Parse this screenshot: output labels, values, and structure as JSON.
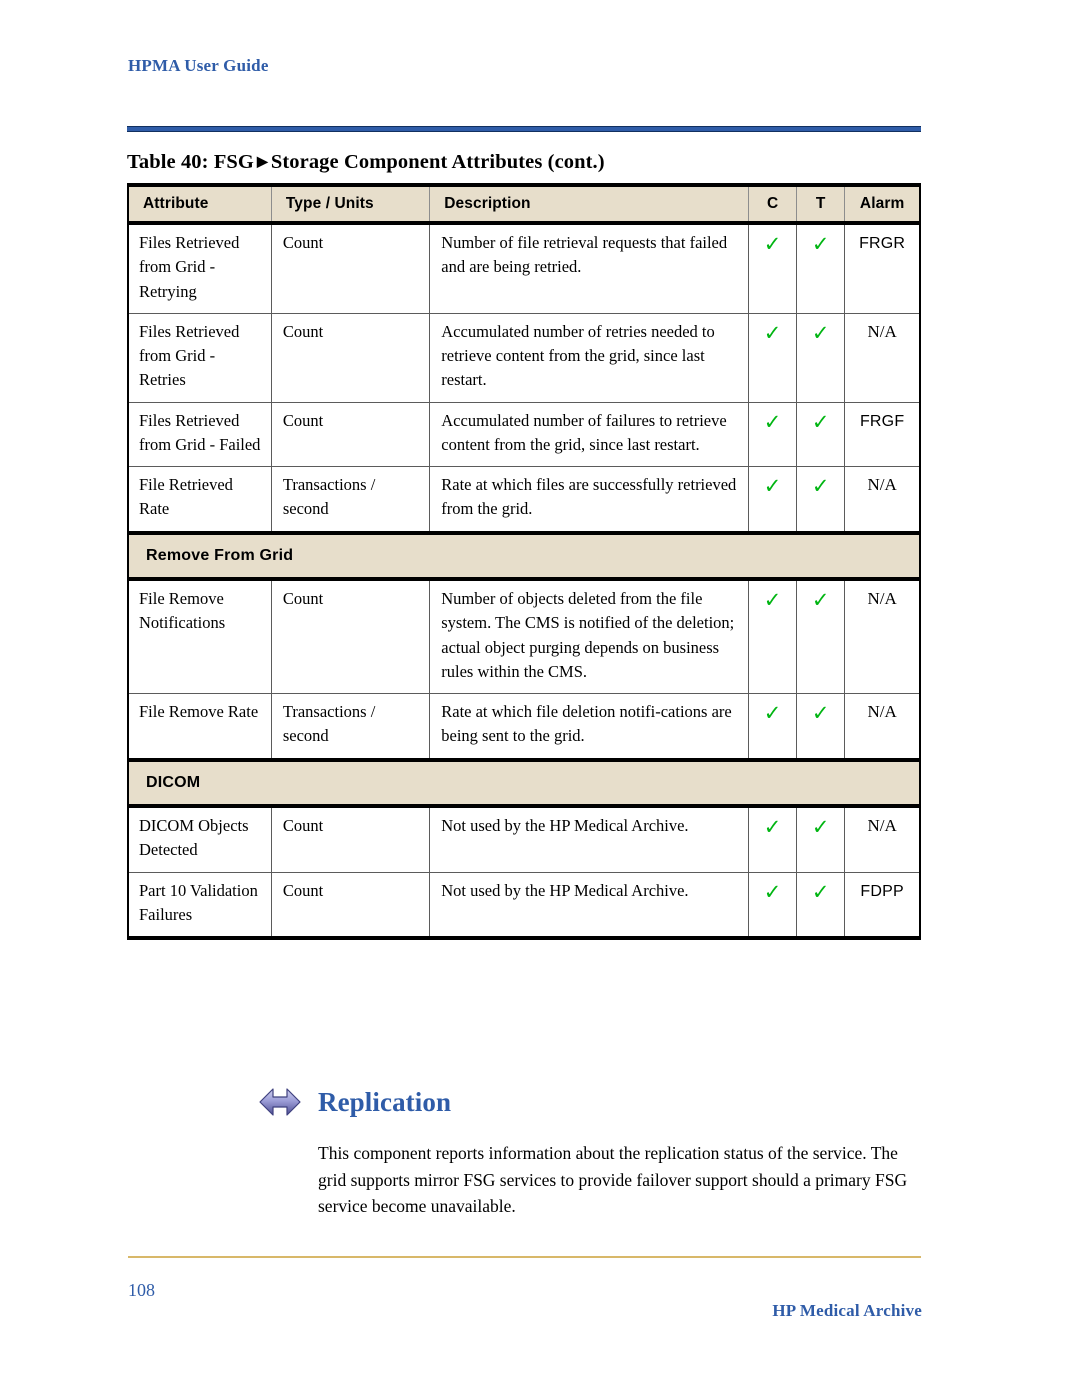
{
  "header": {
    "running_title": "HPMA User Guide"
  },
  "table": {
    "caption_prefix": "Table 40: FSG",
    "caption_arrow": "▶",
    "caption_suffix": "Storage Component Attributes (cont.)",
    "columns": [
      "Attribute",
      "Type / Units",
      "Description",
      "C",
      "T",
      "Alarm"
    ],
    "rows": [
      {
        "kind": "data",
        "attribute": "Files Retrieved from Grid - Retrying",
        "type_units": "Count",
        "description": "Number of file retrieval requests that failed and are being retried.",
        "c": "✓",
        "t": "✓",
        "alarm": "FRGR",
        "alarm_style": "code"
      },
      {
        "kind": "data",
        "attribute": "Files Retrieved from Grid - Retries",
        "type_units": "Count",
        "description": "Accumulated number of retries needed to retrieve content from the grid, since last restart.",
        "c": "✓",
        "t": "✓",
        "alarm": "N/A",
        "alarm_style": "na"
      },
      {
        "kind": "data",
        "attribute": "Files Retrieved from Grid - Failed",
        "type_units": "Count",
        "description": "Accumulated number of failures to retrieve content from the grid, since last restart.",
        "c": "✓",
        "t": "✓",
        "alarm": "FRGF",
        "alarm_style": "code"
      },
      {
        "kind": "data",
        "attribute": "File Retrieved Rate",
        "type_units": "Transactions / second",
        "description": "Rate at which files are successfully retrieved from the grid.",
        "c": "✓",
        "t": "✓",
        "alarm": "N/A",
        "alarm_style": "na"
      },
      {
        "kind": "section",
        "label": "Remove From Grid"
      },
      {
        "kind": "data",
        "attribute": "File Remove Notifications",
        "type_units": "Count",
        "description": "Number of objects deleted from the file system. The CMS is notified of the deletion; actual object purging depends on business rules within the CMS.",
        "c": "✓",
        "t": "✓",
        "alarm": "N/A",
        "alarm_style": "na"
      },
      {
        "kind": "data",
        "attribute": "File Remove Rate",
        "type_units": "Transactions / second",
        "description": "Rate at which file deletion notifi-cations are being sent to the grid.",
        "c": "✓",
        "t": "✓",
        "alarm": "N/A",
        "alarm_style": "na"
      },
      {
        "kind": "section",
        "label": "DICOM"
      },
      {
        "kind": "data",
        "attribute": "DICOM Objects Detected",
        "type_units": "Count",
        "description": "Not used by the HP Medical Archive.",
        "c": "✓",
        "t": "✓",
        "alarm": "N/A",
        "alarm_style": "na"
      },
      {
        "kind": "data",
        "attribute": "Part 10 Validation Failures",
        "type_units": "Count",
        "description": "Not used by the HP Medical Archive.",
        "c": "✓",
        "t": "✓",
        "alarm": "FDPP",
        "alarm_style": "code"
      }
    ]
  },
  "replication": {
    "icon": "double-arrow-icon",
    "title": "Replication",
    "body": "This component reports information about the replication status of the service. The grid supports mirror FSG services to provide failover support should a primary FSG service become unavailable."
  },
  "footer": {
    "page_number": "108",
    "product_name": "HP Medical Archive"
  },
  "colors": {
    "accent_blue": "#2f5ca8",
    "table_header_bg": "#e7decb",
    "check_green": "#00b512",
    "footer_rule": "#d8b869"
  }
}
